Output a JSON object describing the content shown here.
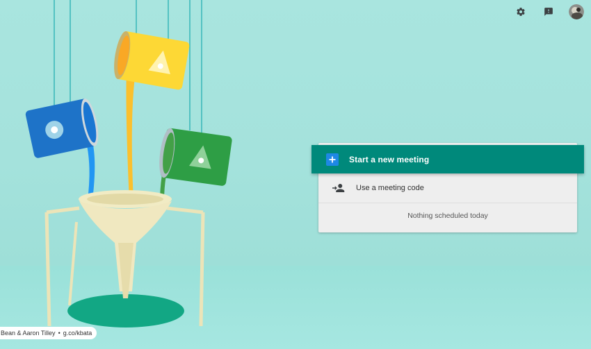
{
  "toolbar": {
    "settings_icon": "gear-icon",
    "feedback_icon": "feedback-icon",
    "avatar_icon": "avatar"
  },
  "actions": {
    "start_meeting_label": "Start a new meeting",
    "meeting_code_label": "Use a meeting code"
  },
  "schedule": {
    "empty_text": "Nothing scheduled today"
  },
  "credit": {
    "artists": "Bean & Aaron Tilley",
    "separator": "•",
    "link": "g.co/kbata"
  },
  "colors": {
    "primary": "#00897b",
    "plus_box": "#1e88e5",
    "background": "#a9e5df"
  }
}
